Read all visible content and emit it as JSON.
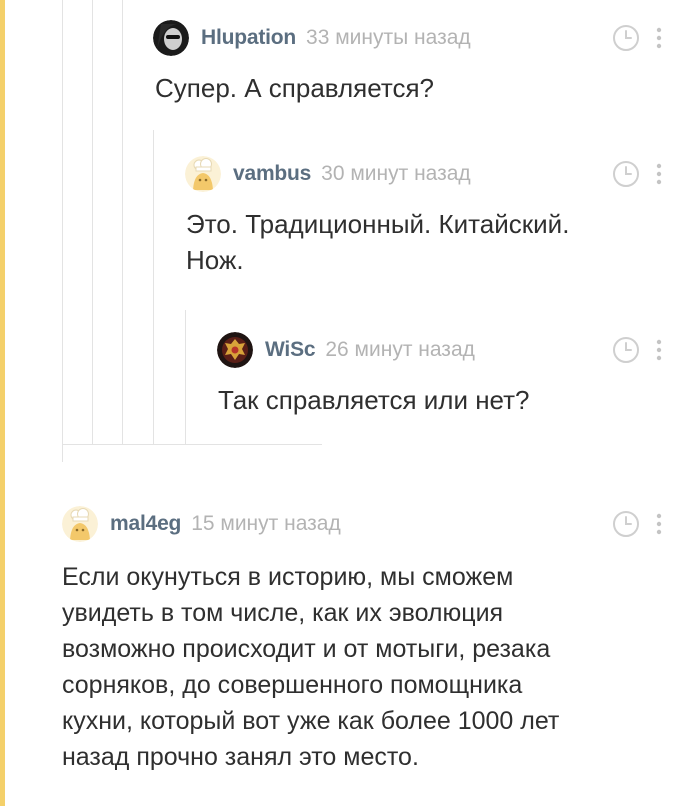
{
  "comments": [
    {
      "author": "Hlupation",
      "time": "33 минуты назад",
      "text": "Супер. А справляется?",
      "avatar_icon": "dark-face-avatar-icon"
    },
    {
      "author": "vambus",
      "time": "30 минут назад",
      "text_lines": [
        "Это. Традиционный. Китайский.",
        "Нож."
      ],
      "avatar_icon": "chef-default-avatar-icon"
    },
    {
      "author": "WiSc",
      "time": "26 минут назад",
      "text": "Так справляется или нет?",
      "avatar_icon": "emblem-avatar-icon"
    },
    {
      "author": "mal4eg",
      "time": "15 минут назад",
      "text_lines": [
        "Если окунуться в историю, мы сможем",
        "увидеть в том числе, как их эволюция",
        "возможно происходит и от мотыги, резака",
        "сорняков, до совершенного помощника",
        "кухни, который вот уже как более 1000 лет",
        "назад прочно занял это место."
      ],
      "avatar_icon": "chef-default-avatar-icon"
    }
  ],
  "icons": {
    "clock": "clock-icon",
    "more": "more-vertical-icon"
  },
  "colors": {
    "accent": "#f4d06a",
    "author": "#5b6e80",
    "time": "#b3b3b3",
    "text": "#2f2f2f",
    "thread_line": "#e3e3e3"
  }
}
